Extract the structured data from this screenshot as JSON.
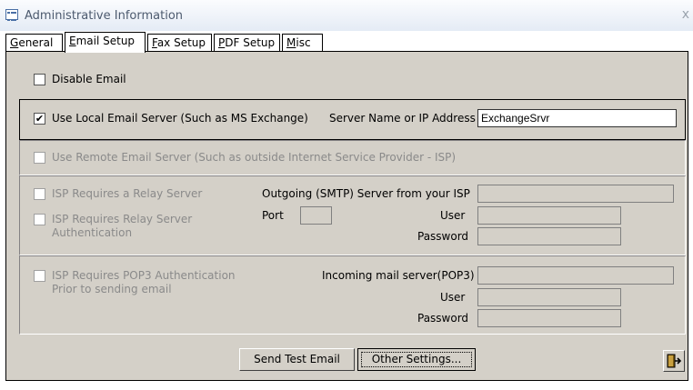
{
  "window": {
    "title": "Administrative Information",
    "close": "x"
  },
  "tabs": [
    {
      "label": "General",
      "key": "G"
    },
    {
      "label": "Email Setup",
      "key": "E"
    },
    {
      "label": "Fax Setup",
      "key": "F"
    },
    {
      "label": "PDF Setup",
      "key": "P"
    },
    {
      "label": "Misc",
      "key": "M"
    }
  ],
  "disable_email": {
    "label": "Disable Email",
    "checked": false
  },
  "local_server": {
    "label": "Use Local Email Server (Such as MS Exchange)",
    "checked": true,
    "server_label": "Server Name or IP Address",
    "server_value": "ExchangeSrvr"
  },
  "remote_server": {
    "label": "Use Remote Email Server (Such as outside Internet Service Provider - ISP)",
    "checked": false
  },
  "relay": {
    "relay_label": "ISP Requires a Relay Server",
    "auth_label_1": "ISP Requires Relay Server",
    "auth_label_2": "Authentication",
    "smtp_label": "Outgoing (SMTP) Server from your ISP",
    "port_label": "Port",
    "user_label": "User",
    "password_label": "Password"
  },
  "pop3": {
    "label_1": "ISP Requires POP3 Authentication",
    "label_2": "Prior to sending email",
    "incoming_label": "Incoming mail server(POP3)",
    "user_label": "User",
    "password_label": "Password"
  },
  "buttons": {
    "send_test": "Send Test Email",
    "other_settings": "Other Settings..."
  }
}
